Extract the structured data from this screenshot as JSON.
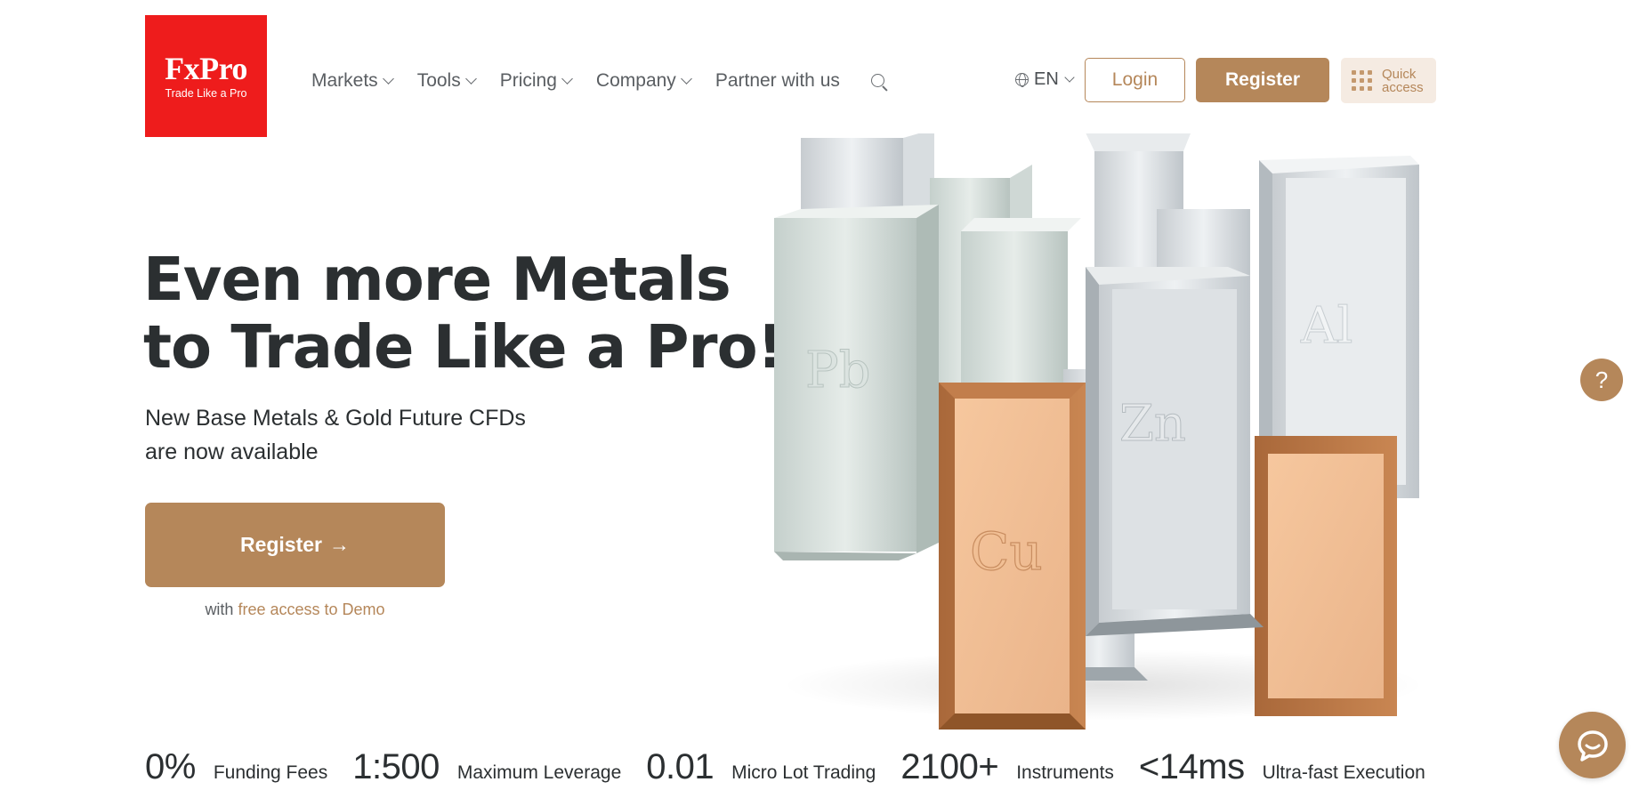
{
  "brand": {
    "name": "FxPro",
    "tagline": "Trade Like a Pro",
    "color": "#ee1c1c",
    "accent": "#b5875a"
  },
  "nav": {
    "items": [
      {
        "label": "Markets",
        "dropdown": true
      },
      {
        "label": "Tools",
        "dropdown": true
      },
      {
        "label": "Pricing",
        "dropdown": true
      },
      {
        "label": "Company",
        "dropdown": true
      },
      {
        "label": "Partner with us",
        "dropdown": false
      }
    ],
    "search_icon": "search-icon"
  },
  "header": {
    "language": "EN",
    "login_label": "Login",
    "register_label": "Register",
    "quick_access_line1": "Quick",
    "quick_access_line2": "access"
  },
  "hero": {
    "title_line1": "Even more Metals",
    "title_line2": "to Trade Like a Pro!",
    "subtitle_line1": "New Base Metals & Gold Future CFDs",
    "subtitle_line2": "are now available",
    "cta_label": "Register",
    "cta_arrow": "→",
    "demo_prefix": "with",
    "demo_link": "free access to Demo"
  },
  "metals": {
    "symbols": [
      "Pb",
      "Cu",
      "Zn",
      "Al"
    ]
  },
  "stats": [
    {
      "value": "0%",
      "label": "Funding Fees"
    },
    {
      "value": "1:500",
      "label": "Maximum Leverage"
    },
    {
      "value": "0.01",
      "label": "Micro Lot Trading"
    },
    {
      "value": "2100+",
      "label": "Instruments"
    },
    {
      "value": "<14ms",
      "label": "Ultra-fast Execution"
    }
  ],
  "floating": {
    "help_label": "?",
    "chat_icon": "chat-icon"
  }
}
